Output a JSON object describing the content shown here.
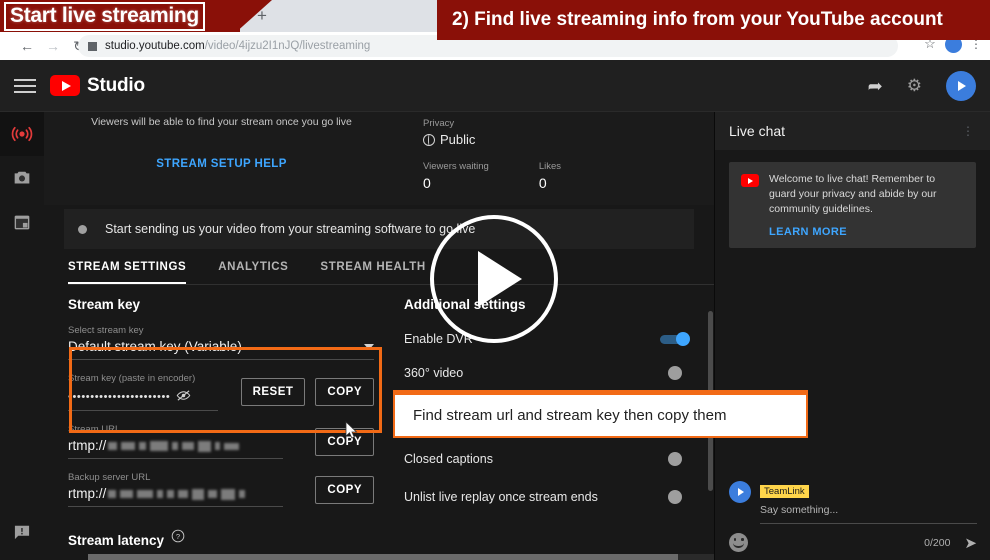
{
  "browser": {
    "tab_title": "Start live streaming",
    "new_tab_label": "+",
    "url_prefix": "studio.youtube.com",
    "url_suffix": "/video/4ijzu2I1nJQ/livestreaming",
    "back_icon": "←",
    "forward_icon": "→",
    "reload_icon": "↻",
    "star_icon": "☆",
    "menu_icon": "⋮"
  },
  "annotation": {
    "step_banner": "2) Find live streaming info from your YouTube account",
    "callout": "Find stream url and stream key then copy them",
    "accent_color": "#f26a16",
    "banner_color": "#8a1008"
  },
  "studio_header": {
    "brand": "Studio",
    "share_icon": "➦",
    "gear_icon": "⚙"
  },
  "rail": {
    "items": [
      {
        "name": "live-streaming",
        "icon": "broadcast-icon",
        "active": true
      },
      {
        "name": "webcam",
        "icon": "camera-icon",
        "active": false
      },
      {
        "name": "schedule",
        "icon": "calendar-icon",
        "active": false
      }
    ],
    "feedback_icon": "feedback-icon"
  },
  "hero": {
    "note": "Viewers will be able to find your stream once you go live",
    "help_link": "STREAM SETUP HELP",
    "privacy_label": "Privacy",
    "privacy_value": "Public",
    "viewers_label": "Viewers waiting",
    "viewers_value": "0",
    "likes_label": "Likes",
    "likes_value": "0"
  },
  "status": {
    "text": "Start sending us your video from your streaming software to go live"
  },
  "tabs": [
    {
      "label": "STREAM SETTINGS",
      "active": true
    },
    {
      "label": "ANALYTICS",
      "active": false
    },
    {
      "label": "STREAM HEALTH",
      "active": false
    }
  ],
  "stream_key_section": {
    "title": "Stream key",
    "select_label": "Select stream key",
    "select_value": "Default stream key (Variable)",
    "key_label": "Stream key (paste in encoder)",
    "key_value": "•••••••••••••••••••••••",
    "eye_icon": "eye-off-icon",
    "reset_label": "RESET",
    "copy_label": "COPY",
    "stream_url_label": "Stream URL",
    "stream_url_value": "rtmp://",
    "stream_url_copy_label": "COPY",
    "backup_url_label": "Backup server URL",
    "backup_url_value": "rtmp://",
    "backup_url_copy_label": "COPY",
    "latency_label": "Stream latency",
    "latency_help_icon": "help-icon"
  },
  "additional_settings": {
    "title": "Additional settings",
    "toggles": [
      {
        "label": "Enable DVR",
        "on": true
      },
      {
        "label": "360° video",
        "on": false
      },
      {
        "label": "Closed captions",
        "on": false
      },
      {
        "label": "Unlist live replay once stream ends",
        "on": false
      }
    ]
  },
  "live_chat": {
    "title": "Live chat",
    "menu_icon": "⋮",
    "welcome_message": "Welcome to live chat! Remember to guard your privacy and abide by our community guidelines.",
    "learn_more": "LEARN MORE",
    "username": "TeamLink",
    "input_placeholder": "Say something...",
    "char_counter": "0/200",
    "emoji_icon": "emoji-icon",
    "send_icon": "➤"
  }
}
